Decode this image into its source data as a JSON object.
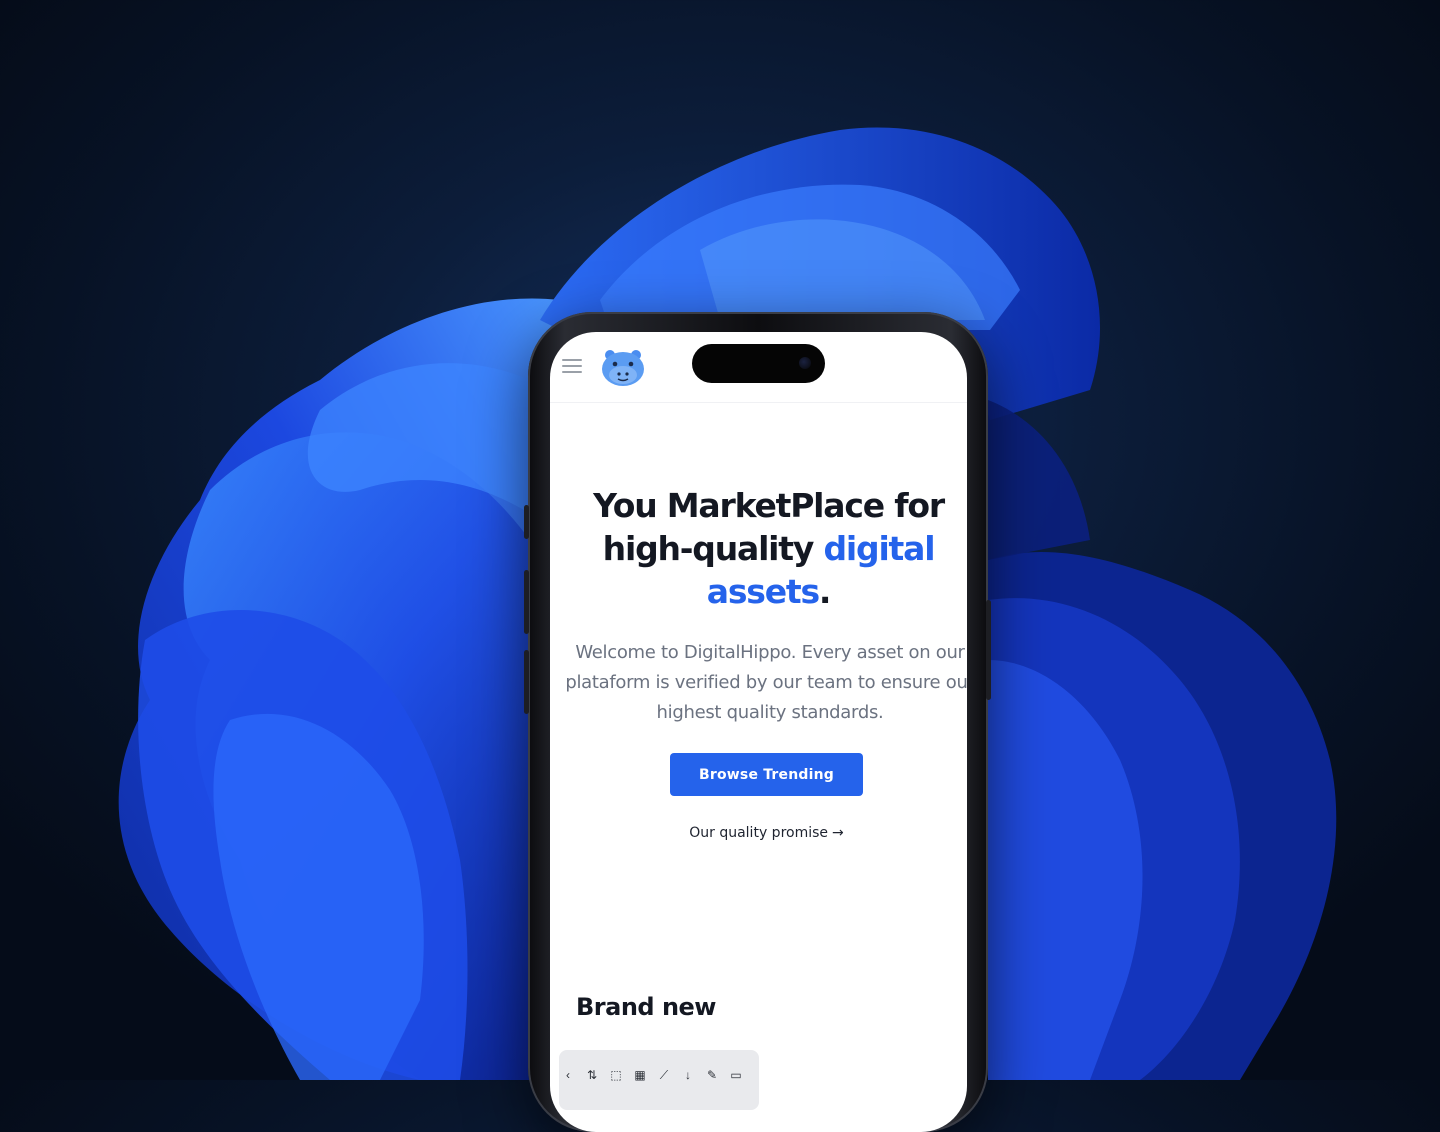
{
  "navbar": {
    "menu_icon": "hamburger-menu-icon",
    "logo_icon": "hippo-logo-icon"
  },
  "hero": {
    "title_line1": "You MarketPlace for",
    "title_line2_plain": "high-quality",
    "title_line2_accent": "digital",
    "title_line3_accent": "assets",
    "title_line3_period": ".",
    "description": "Welcome to DigitalHippo. Every asset on our plataform is verified by our team to ensure our highest quality standards.",
    "cta_label": "Browse Trending",
    "promise_label": "Our quality promise",
    "promise_arrow": "→"
  },
  "section": {
    "title": "Brand new"
  },
  "toolbar": {
    "icons": [
      "chevron-left-icon",
      "filter-icon",
      "select-box-icon",
      "checker-icon",
      "brush-icon",
      "download-icon",
      "pen-icon",
      "save-icon"
    ]
  },
  "colors": {
    "accent": "#2563eb",
    "text_dark": "#141822",
    "text_muted": "#6b7280",
    "background_navy": "#0c1d3a"
  }
}
